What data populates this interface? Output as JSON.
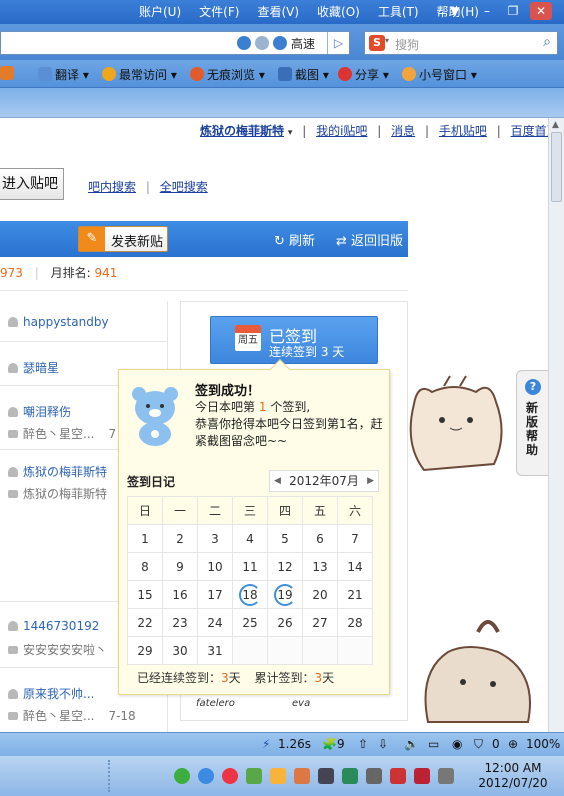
{
  "browser": {
    "menu": [
      "账户(U)",
      "文件(F)",
      "查看(V)",
      "收藏(O)",
      "工具(T)",
      "帮助(H)"
    ],
    "address_mode": "高速",
    "search_placeholder": "搜狗",
    "toolbar": [
      "翻译",
      "最常访问",
      "无痕浏览",
      "截图",
      "分享",
      "小号窗口"
    ]
  },
  "page": {
    "top_links": {
      "user": "炼狱の梅菲斯特",
      "links": [
        "我的i贴吧",
        "消息",
        "手机贴吧",
        "百度首页"
      ]
    },
    "enter_button": "进入贴吧",
    "search_links": [
      "吧内搜索",
      "全吧搜索"
    ],
    "post_button": "发表新贴",
    "refresh": "刷新",
    "old_version": "返回旧版",
    "rank": {
      "partial": "973",
      "month_label": "月排名:",
      "month_value": "941"
    },
    "threads": [
      {
        "author": "happystandby"
      },
      {
        "author": "瑟暗星"
      },
      {
        "author": "嘲泪释伤",
        "reply": "醉色丶星空...",
        "date": "7"
      },
      {
        "author": "炼狱の梅菲斯特",
        "reply": "炼狱の梅菲斯特"
      },
      {
        "author": "1446730192",
        "reply": "安安安安安啦丶"
      },
      {
        "author": "原来我不帅...",
        "reply": "醉色丶星空...",
        "date": "7-18"
      }
    ],
    "signed": {
      "title": "已签到",
      "subtitle": "连续签到 3 天",
      "weekday": "周五"
    },
    "help_tab": {
      "q": "?",
      "text": "新版帮助"
    },
    "bottom_names": [
      "fatelero",
      "eva"
    ]
  },
  "popup": {
    "title": "签到成功！",
    "line2_pre": "今日本吧第",
    "line2_num": "1",
    "line2_post": "个签到,",
    "line3": "恭喜你抢得本吧今日签到第1名，赶紧截图留念吧~~",
    "diary_title": "签到日记",
    "month": "2012年07月",
    "weekdays": [
      "日",
      "一",
      "二",
      "三",
      "四",
      "五",
      "六"
    ],
    "weeks": [
      [
        "1",
        "2",
        "3",
        "4",
        "5",
        "6",
        "7"
      ],
      [
        "8",
        "9",
        "10",
        "11",
        "12",
        "13",
        "14"
      ],
      [
        "15",
        "16",
        "17",
        "18",
        "19",
        "20",
        "21"
      ],
      [
        "22",
        "23",
        "24",
        "25",
        "26",
        "27",
        "28"
      ],
      [
        "29",
        "30",
        "31",
        "",
        "",
        "",
        ""
      ]
    ],
    "signed_days": [
      "18",
      "19"
    ],
    "footer_label1": "已经连续签到：",
    "footer_val1": "3",
    "footer_unit": "天",
    "footer_label2": "累计签到：",
    "footer_val2": "3"
  },
  "statusbar": {
    "time": "1.26s",
    "count": "9",
    "zero": "0",
    "zoom": "100%"
  },
  "taskbar": {
    "time": "12:00 AM",
    "date": "2012/07/20"
  }
}
